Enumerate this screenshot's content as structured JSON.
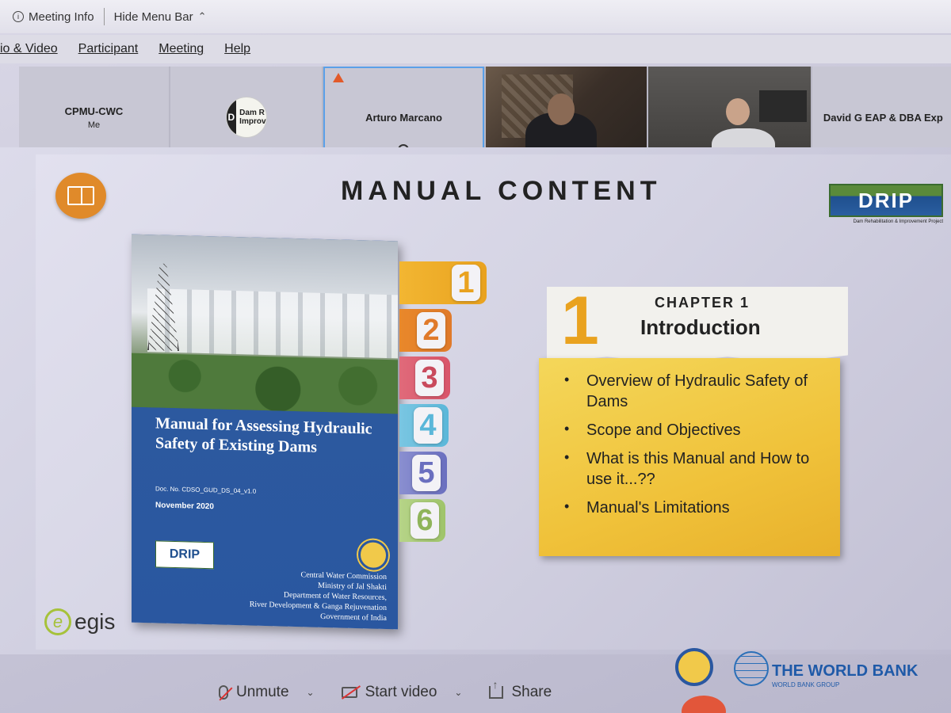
{
  "topbar": {
    "meeting_info": "Meeting Info",
    "hide_menu_bar": "Hide Menu Bar"
  },
  "menubar": {
    "items": [
      "io & Video",
      "Participant",
      "Meeting",
      "Help"
    ]
  },
  "participants": [
    {
      "name": "CPMU-CWC",
      "sub": "Me"
    },
    {
      "name": "Dam R\nImprov"
    },
    {
      "name": "Arturo Marcano"
    },
    {
      "name": ""
    },
    {
      "name": ""
    },
    {
      "name": "David G EAP & DBA Exp"
    }
  ],
  "slide": {
    "title": "MANUAL CONTENT",
    "drip_logo_text": "DRIP",
    "drip_logo_caption": "Dam Rehabilitation & Improvement Project",
    "cover": {
      "title": "Manual for Assessing Hydraulic Safety of Existing Dams",
      "doc_no": "Doc. No. CDSO_GUD_DS_04_v1.0",
      "date": "November 2020",
      "drip": "DRIP",
      "org_lines": [
        "Central Water Commission",
        "Ministry of Jal Shakti",
        "Department of Water Resources,",
        "River Development & Ganga Rejuvenation",
        "Government of India"
      ]
    },
    "tabs": [
      "1",
      "2",
      "3",
      "4",
      "5",
      "6"
    ],
    "chapter": {
      "number": "1",
      "label": "CHAPTER 1",
      "title": "Introduction"
    },
    "bullets": [
      "Overview of Hydraulic Safety of Dams",
      "Scope and Objectives",
      "What is this Manual and How to use it...??",
      "Manual's Limitations"
    ],
    "footer": {
      "egis": "egis",
      "world_bank": "THE WORLD BANK",
      "world_bank_sub": "WORLD BANK GROUP"
    }
  },
  "toolbar": {
    "unmute": "Unmute",
    "start_video": "Start video",
    "share": "Share"
  },
  "colors": {
    "tab_colors": [
      "#e9a21f",
      "#e07a2a",
      "#d9556a",
      "#5ab7d9",
      "#6a6fbf",
      "#9fc46a"
    ],
    "accent_yellow": "#f0c23a",
    "zoom_blue": "#5aa0e8"
  }
}
